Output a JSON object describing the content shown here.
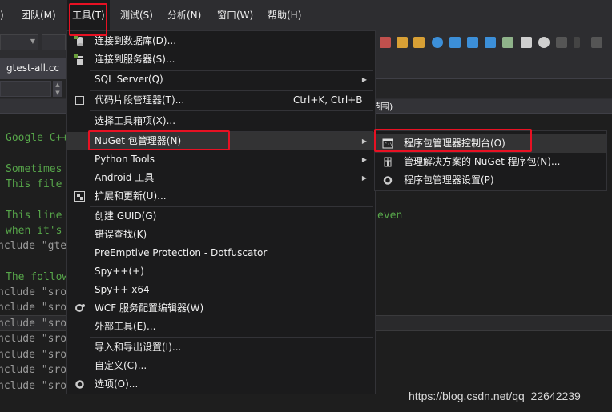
{
  "menubar": {
    "items": [
      {
        "label": ")"
      },
      {
        "label": "团队(M)"
      },
      {
        "label": "工具(T)"
      },
      {
        "label": "测试(S)"
      },
      {
        "label": "分析(N)"
      },
      {
        "label": "窗口(W)"
      },
      {
        "label": "帮助(H)"
      }
    ]
  },
  "tabs": {
    "doc_tab": "gtest-all.cc"
  },
  "scope_bar": {
    "text": "范围)"
  },
  "editor": {
    "lines": [
      "Google C++",
      "Sometimes",
      "This file",
      "This line",
      "when it's",
      "nclude \"gte",
      "The follow",
      "nclude \"sro",
      "nclude \"sro",
      "nclude \"sro",
      "nclude \"sro",
      "nclude \"sro",
      "nclude \"sro",
      "nclude \"sro"
    ],
    "right_text": "even"
  },
  "tools_menu": {
    "items": [
      {
        "label": "连接到数据库(D)...",
        "icon": "database-connect-icon"
      },
      {
        "label": "连接到服务器(S)...",
        "icon": "server-connect-icon"
      },
      {
        "label": "SQL Server(Q)"
      },
      {
        "label": "代码片段管理器(T)...",
        "shortcut": "Ctrl+K, Ctrl+B",
        "icon": "checkbox-icon"
      },
      {
        "label": "选择工具箱项(X)..."
      },
      {
        "label": "NuGet 包管理器(N)"
      },
      {
        "label": "Python Tools"
      },
      {
        "label": "Android 工具"
      },
      {
        "label": "扩展和更新(U)...",
        "icon": "extensions-icon"
      },
      {
        "label": "创建 GUID(G)"
      },
      {
        "label": "错误查找(K)"
      },
      {
        "label": "PreEmptive Protection - Dotfuscator"
      },
      {
        "label": "Spy++(+)"
      },
      {
        "label": "Spy++ x64"
      },
      {
        "label": "WCF 服务配置编辑器(W)",
        "icon": "wcf-gear-icon"
      },
      {
        "label": "外部工具(E)..."
      },
      {
        "label": "导入和导出设置(I)..."
      },
      {
        "label": "自定义(C)..."
      },
      {
        "label": "选项(O)...",
        "icon": "gear-icon"
      }
    ]
  },
  "nuget_submenu": {
    "items": [
      {
        "label": "程序包管理器控制台(O)",
        "icon": "console-icon"
      },
      {
        "label": "管理解决方案的 NuGet 程序包(N)...",
        "icon": "package-icon"
      },
      {
        "label": "程序包管理器设置(P)",
        "icon": "settings-gear-icon"
      }
    ]
  },
  "watermark": "https://blog.csdn.net/qq_22642239",
  "colors": {
    "highlight_red": "#e81123",
    "comment_green": "#57a64a",
    "menu_bg": "#1b1b1c",
    "chrome_bg": "#2d2d30"
  }
}
